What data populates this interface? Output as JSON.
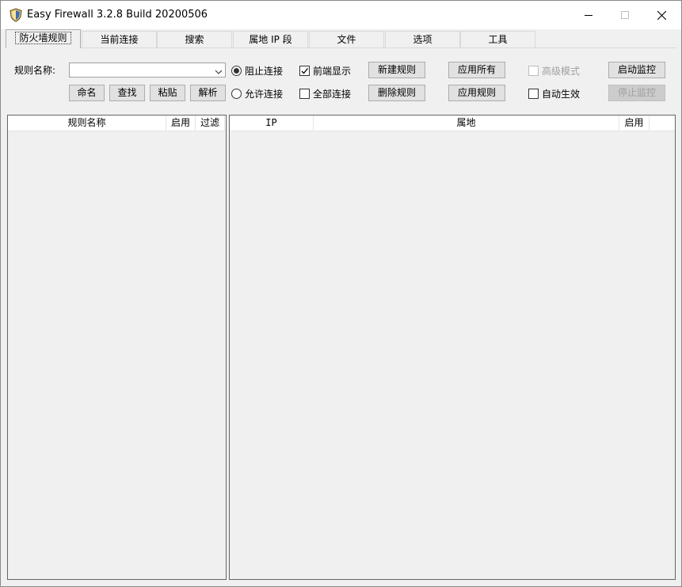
{
  "window": {
    "title": "Easy Firewall 3.2.8 Build 20200506"
  },
  "tabs": [
    {
      "label": "防火墙规则"
    },
    {
      "label": "当前连接"
    },
    {
      "label": "搜索"
    },
    {
      "label": "属地 IP 段"
    },
    {
      "label": "文件"
    },
    {
      "label": "选项"
    },
    {
      "label": "工具"
    }
  ],
  "rule_panel": {
    "rule_name_label": "规则名称:",
    "rule_name_value": "",
    "buttons": {
      "rename": "命名",
      "find": "查找",
      "paste": "粘贴",
      "parse": "解析",
      "new_rule": "新建规则",
      "delete_rule": "删除规则",
      "apply_all": "应用所有",
      "apply_rule": "应用规则",
      "start_monitor": "启动监控",
      "stop_monitor": "停止监控"
    },
    "radios": {
      "block": "阻止连接",
      "allow": "允许连接"
    },
    "checks": {
      "front_display": "前端显示",
      "all_connections": "全部连接",
      "advanced_mode": "高级模式",
      "auto_apply": "自动生效"
    }
  },
  "rules_list": {
    "columns": [
      "规则名称",
      "启用",
      "过滤"
    ]
  },
  "ip_list": {
    "columns": [
      "IP",
      "属地",
      "启用"
    ]
  }
}
